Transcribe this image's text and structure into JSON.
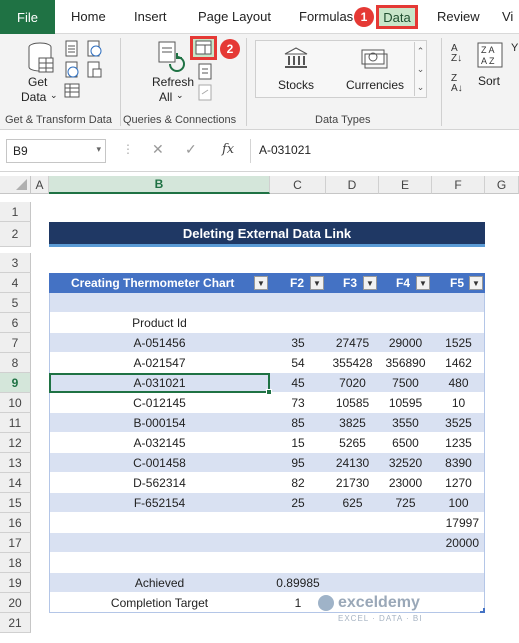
{
  "tabs": [
    "File",
    "Home",
    "Insert",
    "Page Layout",
    "Formulas",
    "Data",
    "Review",
    "Vi"
  ],
  "badges": [
    "1",
    "2"
  ],
  "ribbon": {
    "get_data": "Get",
    "get_data2": "Data",
    "refresh": "Refresh",
    "refresh2": "All",
    "stocks": "Stocks",
    "currencies": "Currencies",
    "sort": "Sort",
    "groups": [
      "Get & Transform Data",
      "Queries & Connections",
      "Data Types"
    ]
  },
  "formula_bar": {
    "name_box": "B9",
    "fx": "fx",
    "content": "A-031021"
  },
  "columns": [
    "A",
    "B",
    "C",
    "D",
    "E",
    "F",
    "G"
  ],
  "rows": [
    "1",
    "2",
    "3",
    "4",
    "5",
    "6",
    "7",
    "8",
    "9",
    "10",
    "11",
    "12",
    "13",
    "14",
    "15",
    "16",
    "17",
    "18",
    "19",
    "20",
    "21"
  ],
  "sheet": {
    "title": "Deleting External Data Link",
    "headers": [
      "Creating Thermometer Chart",
      "F2",
      "F3",
      "F4",
      "F5"
    ],
    "product_id_label": "Product Id",
    "data_rows": [
      [
        "A-051456",
        "35",
        "27475",
        "29000",
        "1525"
      ],
      [
        "A-021547",
        "54",
        "355428",
        "356890",
        "1462"
      ],
      [
        "A-031021",
        "45",
        "7020",
        "7500",
        "480"
      ],
      [
        "C-012145",
        "73",
        "10585",
        "10595",
        "10"
      ],
      [
        "B-000154",
        "85",
        "3825",
        "3550",
        "3525"
      ],
      [
        "A-032145",
        "15",
        "5265",
        "6500",
        "1235"
      ],
      [
        "C-001458",
        "95",
        "24130",
        "32520",
        "8390"
      ],
      [
        "D-562314",
        "82",
        "21730",
        "23000",
        "1270"
      ],
      [
        "F-652154",
        "25",
        "625",
        "725",
        "100"
      ]
    ],
    "total1": "17997",
    "total2": "20000",
    "achieved_label": "Achieved",
    "achieved_value": "0.89985",
    "target_label": "Completion Target",
    "target_value": "1"
  },
  "watermark": {
    "name": "exceldemy",
    "sub": "EXCEL · DATA · BI"
  }
}
